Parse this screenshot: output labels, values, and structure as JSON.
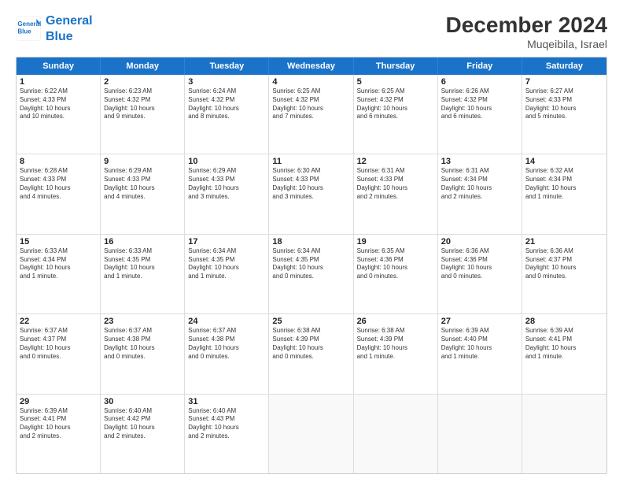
{
  "logo": {
    "line1": "General",
    "line2": "Blue"
  },
  "title": "December 2024",
  "subtitle": "Muqeibila, Israel",
  "header_days": [
    "Sunday",
    "Monday",
    "Tuesday",
    "Wednesday",
    "Thursday",
    "Friday",
    "Saturday"
  ],
  "rows": [
    [
      {
        "day": "1",
        "text": "Sunrise: 6:22 AM\nSunset: 4:33 PM\nDaylight: 10 hours\nand 10 minutes."
      },
      {
        "day": "2",
        "text": "Sunrise: 6:23 AM\nSunset: 4:32 PM\nDaylight: 10 hours\nand 9 minutes."
      },
      {
        "day": "3",
        "text": "Sunrise: 6:24 AM\nSunset: 4:32 PM\nDaylight: 10 hours\nand 8 minutes."
      },
      {
        "day": "4",
        "text": "Sunrise: 6:25 AM\nSunset: 4:32 PM\nDaylight: 10 hours\nand 7 minutes."
      },
      {
        "day": "5",
        "text": "Sunrise: 6:25 AM\nSunset: 4:32 PM\nDaylight: 10 hours\nand 6 minutes."
      },
      {
        "day": "6",
        "text": "Sunrise: 6:26 AM\nSunset: 4:32 PM\nDaylight: 10 hours\nand 6 minutes."
      },
      {
        "day": "7",
        "text": "Sunrise: 6:27 AM\nSunset: 4:33 PM\nDaylight: 10 hours\nand 5 minutes."
      }
    ],
    [
      {
        "day": "8",
        "text": "Sunrise: 6:28 AM\nSunset: 4:33 PM\nDaylight: 10 hours\nand 4 minutes."
      },
      {
        "day": "9",
        "text": "Sunrise: 6:29 AM\nSunset: 4:33 PM\nDaylight: 10 hours\nand 4 minutes."
      },
      {
        "day": "10",
        "text": "Sunrise: 6:29 AM\nSunset: 4:33 PM\nDaylight: 10 hours\nand 3 minutes."
      },
      {
        "day": "11",
        "text": "Sunrise: 6:30 AM\nSunset: 4:33 PM\nDaylight: 10 hours\nand 3 minutes."
      },
      {
        "day": "12",
        "text": "Sunrise: 6:31 AM\nSunset: 4:33 PM\nDaylight: 10 hours\nand 2 minutes."
      },
      {
        "day": "13",
        "text": "Sunrise: 6:31 AM\nSunset: 4:34 PM\nDaylight: 10 hours\nand 2 minutes."
      },
      {
        "day": "14",
        "text": "Sunrise: 6:32 AM\nSunset: 4:34 PM\nDaylight: 10 hours\nand 1 minute."
      }
    ],
    [
      {
        "day": "15",
        "text": "Sunrise: 6:33 AM\nSunset: 4:34 PM\nDaylight: 10 hours\nand 1 minute."
      },
      {
        "day": "16",
        "text": "Sunrise: 6:33 AM\nSunset: 4:35 PM\nDaylight: 10 hours\nand 1 minute."
      },
      {
        "day": "17",
        "text": "Sunrise: 6:34 AM\nSunset: 4:35 PM\nDaylight: 10 hours\nand 1 minute."
      },
      {
        "day": "18",
        "text": "Sunrise: 6:34 AM\nSunset: 4:35 PM\nDaylight: 10 hours\nand 0 minutes."
      },
      {
        "day": "19",
        "text": "Sunrise: 6:35 AM\nSunset: 4:36 PM\nDaylight: 10 hours\nand 0 minutes."
      },
      {
        "day": "20",
        "text": "Sunrise: 6:36 AM\nSunset: 4:36 PM\nDaylight: 10 hours\nand 0 minutes."
      },
      {
        "day": "21",
        "text": "Sunrise: 6:36 AM\nSunset: 4:37 PM\nDaylight: 10 hours\nand 0 minutes."
      }
    ],
    [
      {
        "day": "22",
        "text": "Sunrise: 6:37 AM\nSunset: 4:37 PM\nDaylight: 10 hours\nand 0 minutes."
      },
      {
        "day": "23",
        "text": "Sunrise: 6:37 AM\nSunset: 4:38 PM\nDaylight: 10 hours\nand 0 minutes."
      },
      {
        "day": "24",
        "text": "Sunrise: 6:37 AM\nSunset: 4:38 PM\nDaylight: 10 hours\nand 0 minutes."
      },
      {
        "day": "25",
        "text": "Sunrise: 6:38 AM\nSunset: 4:39 PM\nDaylight: 10 hours\nand 0 minutes."
      },
      {
        "day": "26",
        "text": "Sunrise: 6:38 AM\nSunset: 4:39 PM\nDaylight: 10 hours\nand 1 minute."
      },
      {
        "day": "27",
        "text": "Sunrise: 6:39 AM\nSunset: 4:40 PM\nDaylight: 10 hours\nand 1 minute."
      },
      {
        "day": "28",
        "text": "Sunrise: 6:39 AM\nSunset: 4:41 PM\nDaylight: 10 hours\nand 1 minute."
      }
    ],
    [
      {
        "day": "29",
        "text": "Sunrise: 6:39 AM\nSunset: 4:41 PM\nDaylight: 10 hours\nand 2 minutes."
      },
      {
        "day": "30",
        "text": "Sunrise: 6:40 AM\nSunset: 4:42 PM\nDaylight: 10 hours\nand 2 minutes."
      },
      {
        "day": "31",
        "text": "Sunrise: 6:40 AM\nSunset: 4:43 PM\nDaylight: 10 hours\nand 2 minutes."
      },
      {
        "day": "",
        "text": ""
      },
      {
        "day": "",
        "text": ""
      },
      {
        "day": "",
        "text": ""
      },
      {
        "day": "",
        "text": ""
      }
    ]
  ]
}
